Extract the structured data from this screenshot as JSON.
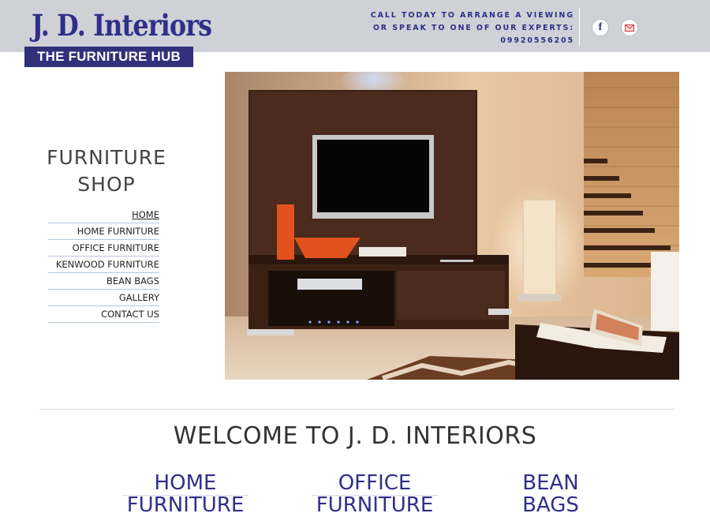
{
  "header": {
    "brand": "J. D. Interiors",
    "tagline": "THE FURNITURE HUB",
    "contact_lines": [
      "CALL TODAY TO ARRANGE A VIEWING",
      "OR SPEAK TO ONE OF OUR EXPERTS:",
      "09920556205"
    ],
    "social_icons": [
      "facebook-icon",
      "mail-icon"
    ]
  },
  "sidebar": {
    "title_line1": "FURNITURE",
    "title_line2": "SHOP",
    "items": [
      {
        "label": "HOME",
        "active": true
      },
      {
        "label": "HOME FURNITURE"
      },
      {
        "label": "OFFICE FURNITURE"
      },
      {
        "label": "KENWOOD FURNITURE"
      },
      {
        "label": "BEAN BAGS"
      },
      {
        "label": "GALLERY"
      },
      {
        "label": "CONTACT US"
      }
    ]
  },
  "main": {
    "welcome": "WELCOME TO J. D. INTERIORS",
    "categories": [
      {
        "line1": "HOME",
        "line2": "FURNITURE"
      },
      {
        "line1": "OFFICE",
        "line2": "FURNITURE"
      },
      {
        "line1": "BEAN",
        "line2": "BAGS"
      }
    ]
  },
  "colors": {
    "brand_navy": "#2f2f8a",
    "header_bg": "#cfd1d6",
    "tagline_bg": "#31307b"
  }
}
